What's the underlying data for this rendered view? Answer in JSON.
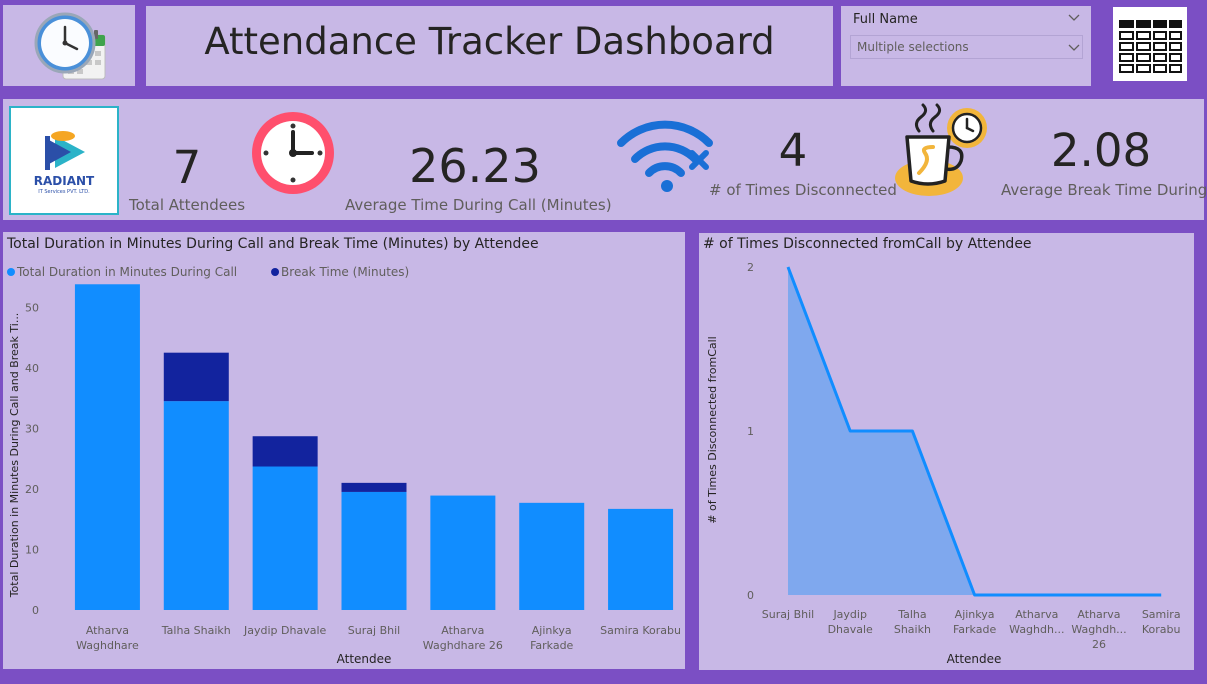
{
  "header": {
    "title": "Attendance Tracker Dashboard"
  },
  "filter": {
    "label": "Full Name",
    "value": "Multiple selections"
  },
  "logo": {
    "name": "RADIANT",
    "subtitle": "IT Services PVT. LTD."
  },
  "kpis": [
    {
      "value": "7",
      "label": "Total Attendees"
    },
    {
      "value": "26.23",
      "label": "Average Time During Call (Minutes)"
    },
    {
      "value": "4",
      "label": "# of Times Disconnected"
    },
    {
      "value": "2.08",
      "label": "Average Break Time During ..."
    }
  ],
  "colors": {
    "page_bg": "#7b4fc4",
    "panel_bg": "#c8b8e6",
    "series_call": "#118dff",
    "series_break": "#12239e",
    "area_fill": "#7fa8ee",
    "area_line": "#118dff"
  },
  "chart_data": [
    {
      "type": "bar",
      "stacked": true,
      "title": "Total Duration in Minutes During Call and Break Time (Minutes) by Attendee",
      "xlabel": "Attendee",
      "ylabel": "Total Duration in Minutes During Call and Break Ti...",
      "legend_position": "top-left",
      "ylim": [
        0,
        55
      ],
      "yticks": [
        0,
        10,
        20,
        30,
        40,
        50
      ],
      "categories": [
        [
          "Atharva",
          "Waghdhare"
        ],
        [
          "Talha Shaikh"
        ],
        [
          "Jaydip Dhavale"
        ],
        [
          "Suraj Bhil"
        ],
        [
          "Atharva",
          "Waghdhare 26"
        ],
        [
          "Ajinkya",
          "Farkade"
        ],
        [
          "Samira Korabu"
        ]
      ],
      "series": [
        {
          "name": "Total Duration in Minutes During Call",
          "values": [
            53.8,
            34.5,
            23.7,
            19.5,
            18.9,
            17.7,
            16.7
          ]
        },
        {
          "name": "Break Time (Minutes)",
          "values": [
            0,
            8.0,
            5.0,
            1.5,
            0,
            0,
            0
          ]
        }
      ],
      "grid": false
    },
    {
      "type": "area",
      "title": "# of Times Disconnected fromCall by Attendee",
      "xlabel": "Attendee",
      "ylabel": "# of Times Disconnected fromCall",
      "ylim": [
        0,
        2
      ],
      "yticks": [
        0,
        1,
        2
      ],
      "categories": [
        [
          "Suraj Bhil"
        ],
        [
          "Jaydip",
          "Dhavale"
        ],
        [
          "Talha",
          "Shaikh"
        ],
        [
          "Ajinkya",
          "Farkade"
        ],
        [
          "Atharva",
          "Waghdh..."
        ],
        [
          "Atharva",
          "Waghdh...",
          "26"
        ],
        [
          "Samira",
          "Korabu"
        ]
      ],
      "values": [
        2,
        1,
        1,
        0,
        0,
        0,
        0
      ],
      "grid": false
    }
  ]
}
